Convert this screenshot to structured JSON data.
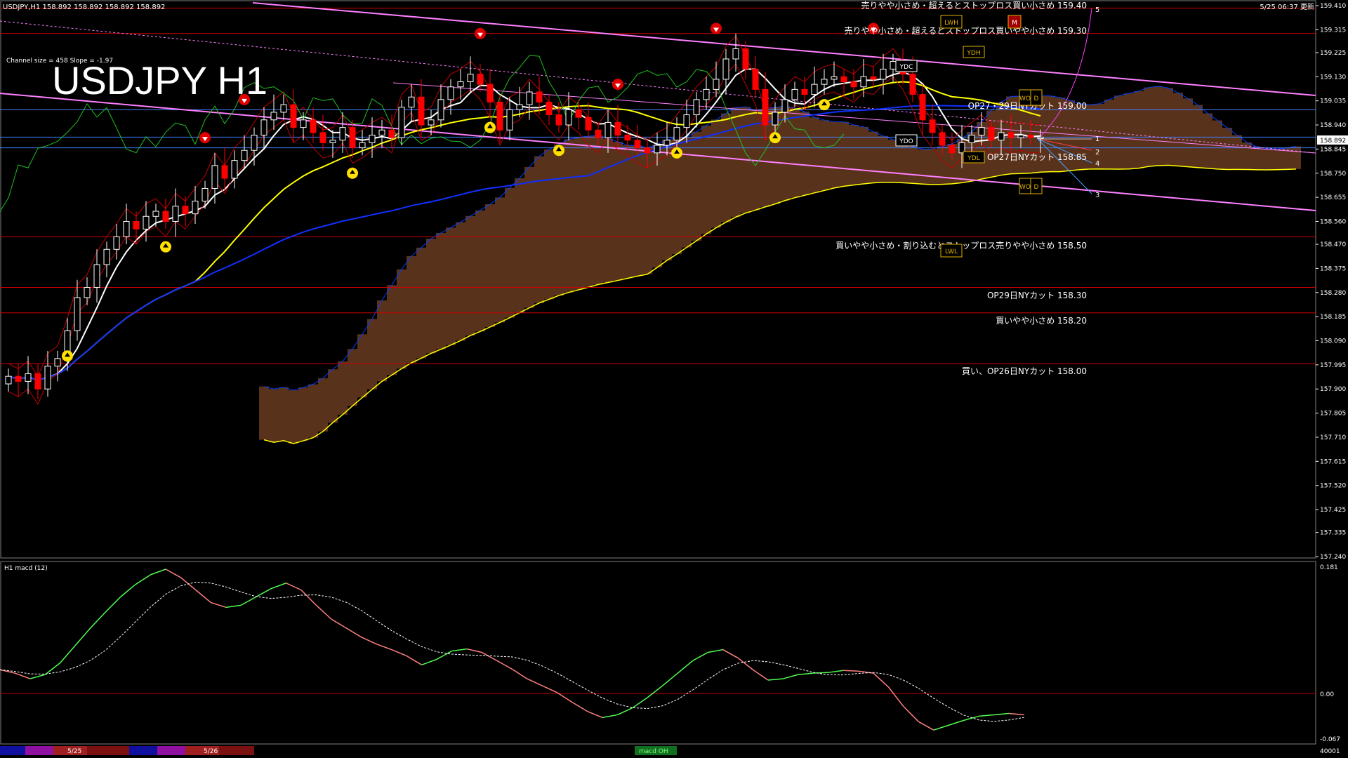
{
  "header": {
    "symbol_info": "USDJPY,H1  158.892 158.892 158.892 158.892",
    "timestamp": "5/25 06:37 更新",
    "channel_info": "Channel size = 458 Slope = -1.97",
    "big_title": "USDJPY H1"
  },
  "colors": {
    "background": "#000000",
    "bull_candle": "#ffffff",
    "bear_candle": "#ff0000",
    "ma_fast": "#ffffff",
    "ma_mid": "#ffff00",
    "ma_slow": "#1030ff",
    "channel": "#ff80ff",
    "level_line": "#d00000",
    "macd_line": "#50ff50",
    "macd_line_down": "#ff8080",
    "macd_signal": "#ffffff",
    "cloud_bull": "#ff9050",
    "cloud_bear": "#2030c0",
    "chikou": "#20c020",
    "kijun": "#ffff00",
    "tenkan": "#0040ff"
  },
  "annotations": {
    "level_159_40": "売りやや小さめ・超えるとストップロス買い小さめ 159.40",
    "level_159_30": "売りやや小さめ・超えるとストップロス買いやや小さめ 159.30",
    "level_159_00": "OP27・29日NYカット 159.00",
    "level_158_85": "OP27日NYカット 158.85",
    "level_158_50": "買いやや小さめ・割り込むとストップロス売りやや小さめ 158.50",
    "level_158_30": "OP29日NYカット 158.30",
    "level_158_20": "買いやや小さめ 158.20",
    "level_158_00": "買い、OP26日NYカット 158.00"
  },
  "markers": {
    "ydc": "YDC",
    "ydo": "YDO",
    "ydh": "YDH",
    "ydl": "YDL",
    "lwh": "LWH",
    "lwl": "LWL",
    "wo": "WO",
    "wd": "D",
    "m": "M",
    "fan_labels": [
      "1",
      "2",
      "3",
      "4",
      "5"
    ]
  },
  "price_axis": {
    "current_price": "158.892",
    "ticks": [
      "159.410",
      "159.315",
      "159.225",
      "159.130",
      "159.035",
      "158.940",
      "158.845",
      "158.750",
      "158.655",
      "158.560",
      "158.470",
      "158.375",
      "158.280",
      "158.185",
      "158.090",
      "157.995",
      "157.900",
      "157.805",
      "157.710",
      "157.615",
      "157.520",
      "157.425",
      "157.335",
      "157.240"
    ]
  },
  "macd_panel": {
    "label": "H1  macd (12)",
    "ticks": [
      "0.181",
      "0.00",
      "-0.067"
    ]
  },
  "bottom_bar": {
    "date_labels": [
      "5/25",
      "5/26"
    ],
    "center_label": "macd OH",
    "right_label": "40001"
  },
  "chart_data": [
    {
      "type": "candlestick",
      "title": "USDJPY H1",
      "ylim": [
        157.24,
        159.41
      ],
      "current_price": 158.892,
      "horizontal_levels": [
        159.4,
        159.3,
        159.0,
        158.85,
        158.5,
        158.3,
        158.2,
        158.0
      ],
      "close_series": [
        157.95,
        157.93,
        157.96,
        157.9,
        157.99,
        158.02,
        158.13,
        158.26,
        158.3,
        158.39,
        158.45,
        158.5,
        158.56,
        158.53,
        158.58,
        158.6,
        158.56,
        158.62,
        158.59,
        158.64,
        158.69,
        158.78,
        158.73,
        158.8,
        158.84,
        158.9,
        158.96,
        158.99,
        159.02,
        158.93,
        158.96,
        158.91,
        158.87,
        158.88,
        158.93,
        158.85,
        158.87,
        158.9,
        158.92,
        158.89,
        159.01,
        159.05,
        158.94,
        158.96,
        159.04,
        159.09,
        159.11,
        159.14,
        159.1,
        159.03,
        158.92,
        159.0,
        159.02,
        159.07,
        159.03,
        158.98,
        158.94,
        159.0,
        158.97,
        158.92,
        158.89,
        158.95,
        158.9,
        158.88,
        158.85,
        158.83,
        158.86,
        158.88,
        158.93,
        158.98,
        159.04,
        159.08,
        159.12,
        159.2,
        159.24,
        159.16,
        159.08,
        158.94,
        158.99,
        159.04,
        159.08,
        159.06,
        159.1,
        159.12,
        159.13,
        159.11,
        159.09,
        159.13,
        159.12,
        159.16,
        159.19,
        159.14,
        159.06,
        158.96,
        158.91,
        158.86,
        158.83,
        158.87,
        158.9,
        158.93,
        158.88,
        158.91,
        158.89,
        158.9,
        158.89,
        158.892
      ]
    },
    {
      "type": "line",
      "title": "H1 macd (12)",
      "ylim": [
        -0.067,
        0.181
      ],
      "series": [
        {
          "name": "macd",
          "values": [
            0.035,
            0.03,
            0.022,
            0.028,
            0.045,
            0.07,
            0.095,
            0.118,
            0.14,
            0.158,
            0.172,
            0.18,
            0.168,
            0.15,
            0.132,
            0.125,
            0.128,
            0.14,
            0.152,
            0.16,
            0.15,
            0.128,
            0.108,
            0.095,
            0.082,
            0.072,
            0.064,
            0.055,
            0.042,
            0.05,
            0.062,
            0.065,
            0.06,
            0.048,
            0.036,
            0.022,
            0.012,
            0.002,
            -0.012,
            -0.025,
            -0.034,
            -0.03,
            -0.02,
            -0.005,
            0.012,
            0.03,
            0.048,
            0.06,
            0.064,
            0.052,
            0.035,
            0.02,
            0.022,
            0.028,
            0.03,
            0.031,
            0.034,
            0.033,
            0.03,
            0.01,
            -0.018,
            -0.04,
            -0.052,
            -0.045,
            -0.038,
            -0.032,
            -0.03,
            -0.028,
            -0.03
          ]
        }
      ]
    }
  ]
}
